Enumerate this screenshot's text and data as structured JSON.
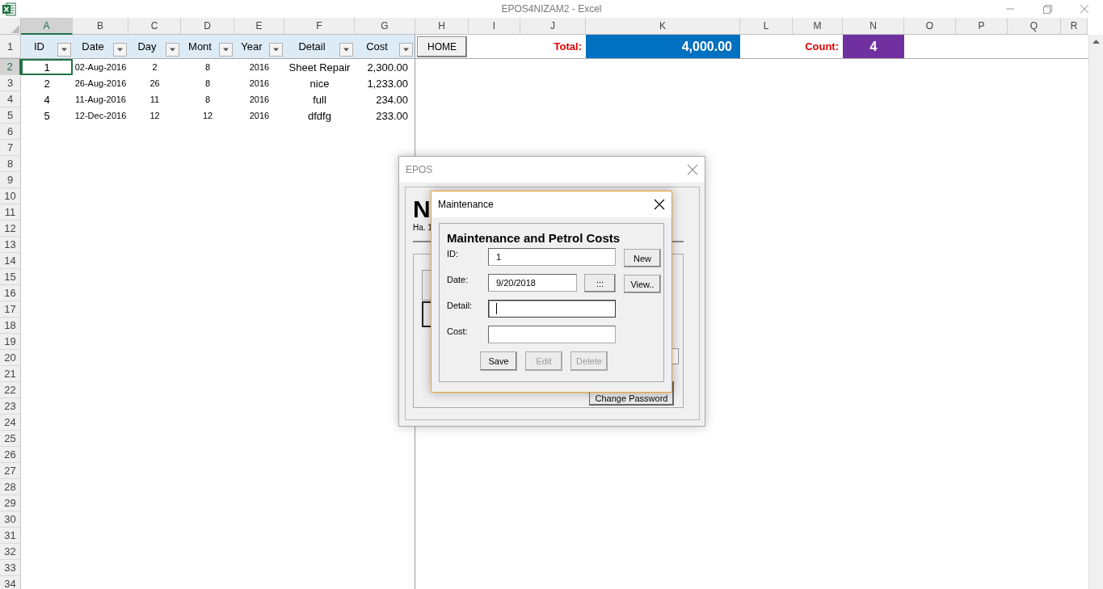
{
  "window": {
    "title": "EPOS4NIZAM2 - Excel"
  },
  "columns": [
    {
      "label": "A",
      "selected": true
    },
    {
      "label": "B",
      "selected": false
    },
    {
      "label": "C",
      "selected": false
    },
    {
      "label": "D",
      "selected": false
    },
    {
      "label": "E",
      "selected": false
    },
    {
      "label": "F",
      "selected": false
    },
    {
      "label": "G",
      "selected": false
    },
    {
      "label": "H",
      "selected": false
    },
    {
      "label": "I",
      "selected": false
    },
    {
      "label": "J",
      "selected": false
    },
    {
      "label": "K",
      "selected": false
    },
    {
      "label": "L",
      "selected": false
    },
    {
      "label": "M",
      "selected": false
    },
    {
      "label": "N",
      "selected": false
    },
    {
      "label": "O",
      "selected": false
    },
    {
      "label": "P",
      "selected": false
    },
    {
      "label": "Q",
      "selected": false
    },
    {
      "label": "R",
      "selected": false
    }
  ],
  "row_headers": [
    {
      "label": "1",
      "selected": false
    },
    {
      "label": "2",
      "selected": true
    },
    {
      "label": "3",
      "selected": false
    },
    {
      "label": "4",
      "selected": false
    },
    {
      "label": "5",
      "selected": false
    },
    {
      "label": "6",
      "selected": false
    },
    {
      "label": "7",
      "selected": false
    },
    {
      "label": "8",
      "selected": false
    },
    {
      "label": "9",
      "selected": false
    },
    {
      "label": "10",
      "selected": false
    },
    {
      "label": "11",
      "selected": false
    },
    {
      "label": "12",
      "selected": false
    },
    {
      "label": "13",
      "selected": false
    },
    {
      "label": "14",
      "selected": false
    },
    {
      "label": "15",
      "selected": false
    },
    {
      "label": "16",
      "selected": false
    },
    {
      "label": "17",
      "selected": false
    },
    {
      "label": "18",
      "selected": false
    },
    {
      "label": "19",
      "selected": false
    },
    {
      "label": "20",
      "selected": false
    },
    {
      "label": "21",
      "selected": false
    },
    {
      "label": "22",
      "selected": false
    },
    {
      "label": "23",
      "selected": false
    },
    {
      "label": "24",
      "selected": false
    },
    {
      "label": "25",
      "selected": false
    },
    {
      "label": "26",
      "selected": false
    },
    {
      "label": "27",
      "selected": false
    },
    {
      "label": "28",
      "selected": false
    },
    {
      "label": "29",
      "selected": false
    },
    {
      "label": "30",
      "selected": false
    },
    {
      "label": "31",
      "selected": false
    },
    {
      "label": "32",
      "selected": false
    },
    {
      "label": "33",
      "selected": false
    },
    {
      "label": "34",
      "selected": false
    }
  ],
  "table": {
    "columns": [
      "ID",
      "Date",
      "Day",
      "Mont",
      "Year",
      "Detail",
      "Cost"
    ],
    "rows": [
      {
        "cells": [
          {
            "text": "1",
            "selected": true
          },
          {
            "text": "02-Aug-2016",
            "selected": false
          },
          {
            "text": "2",
            "selected": false
          },
          {
            "text": "8",
            "selected": false
          },
          {
            "text": "2016",
            "selected": false
          },
          {
            "text": "Sheet Repair",
            "selected": false
          },
          {
            "text": "2,300.00",
            "selected": false
          }
        ]
      },
      {
        "cells": [
          {
            "text": "2",
            "selected": false
          },
          {
            "text": "26-Aug-2016",
            "selected": false
          },
          {
            "text": "26",
            "selected": false
          },
          {
            "text": "8",
            "selected": false
          },
          {
            "text": "2016",
            "selected": false
          },
          {
            "text": "nice",
            "selected": false
          },
          {
            "text": "1,233.00",
            "selected": false
          }
        ]
      },
      {
        "cells": [
          {
            "text": "4",
            "selected": false
          },
          {
            "text": "11-Aug-2016",
            "selected": false
          },
          {
            "text": "11",
            "selected": false
          },
          {
            "text": "8",
            "selected": false
          },
          {
            "text": "2016",
            "selected": false
          },
          {
            "text": "full",
            "selected": false
          },
          {
            "text": "234.00",
            "selected": false
          }
        ]
      },
      {
        "cells": [
          {
            "text": "5",
            "selected": false
          },
          {
            "text": "12-Dec-2016",
            "selected": false
          },
          {
            "text": "12",
            "selected": false
          },
          {
            "text": "12",
            "selected": false
          },
          {
            "text": "2016",
            "selected": false
          },
          {
            "text": "dfdfg",
            "selected": false
          },
          {
            "text": "233.00",
            "selected": false
          }
        ]
      }
    ]
  },
  "summary": {
    "home_button": "HOME",
    "total_label": "Total:",
    "total_value": "4,000.00",
    "count_label": "Count:",
    "count_value": "4"
  },
  "epos_dialog": {
    "title": "EPOS",
    "heading": "N",
    "subtitle": "Ha. 1",
    "button": "Change Password"
  },
  "maintenance_dialog": {
    "title": "Maintenance",
    "heading": "Maintenance and Petrol Costs",
    "fields": [
      {
        "label": "ID:",
        "value": "1",
        "focused": false,
        "button": "New"
      },
      {
        "label": "Date:",
        "value": "9/20/2018",
        "focused": false,
        "picker": ":::",
        "button": "View.."
      },
      {
        "label": "Detail:",
        "focused": true
      },
      {
        "label": "Cost:",
        "focused": false
      }
    ],
    "buttons": [
      {
        "label": "Save",
        "disabled": false
      },
      {
        "label": "Edit",
        "disabled": true
      },
      {
        "label": "Delete",
        "disabled": true
      }
    ]
  }
}
